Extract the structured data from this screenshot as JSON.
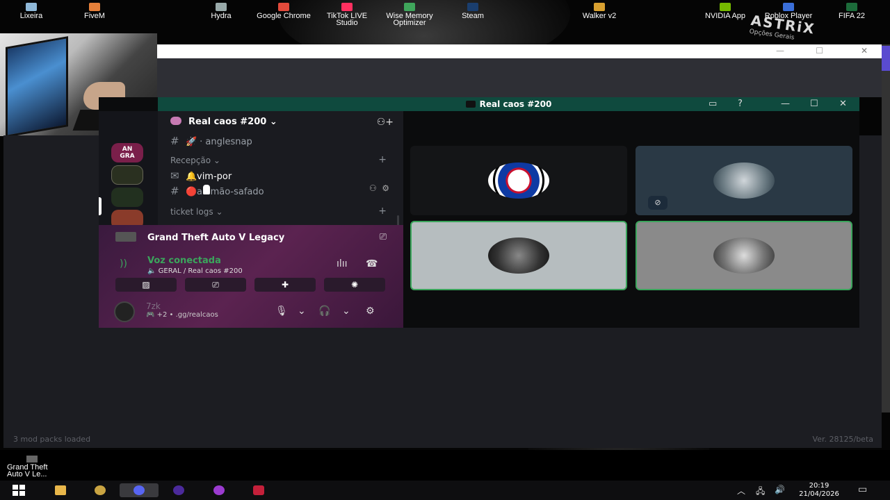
{
  "desktop_icons": [
    {
      "label": "Lixeira",
      "color": "#8fb8d8"
    },
    {
      "label": "FiveM",
      "color": "#e6803a"
    },
    {
      "label": "Hydra",
      "color": "#9aa"
    },
    {
      "label": "Google Chrome",
      "color": "#e24a3b"
    },
    {
      "label": "TikTok LIVE Studio",
      "color": "#ff3060"
    },
    {
      "label": "Wise Memory Optimizer",
      "color": "#3fa65b"
    },
    {
      "label": "Steam",
      "color": "#1a3e6e"
    },
    {
      "label": "Walker v2",
      "color": "#d8a030"
    },
    {
      "label": "NVIDIA App",
      "color": "#76b900"
    },
    {
      "label": "Roblox Player",
      "color": "#3a6ed8"
    },
    {
      "label": "FIFA 22",
      "color": "#1c6b3a"
    }
  ],
  "astrix": {
    "logo": "ASTRiX",
    "sub": "Opções Gerais"
  },
  "launcher": {
    "left_status": "3 mod packs loaded",
    "right_status": "Ver. 28125/beta"
  },
  "whitewin": {
    "min": "—",
    "max": "☐",
    "close": "✕"
  },
  "discord": {
    "window_title": "Real caos #200",
    "titlebar_icons": {
      "inbox": "inbox-icon",
      "help": "help-icon",
      "minimize": "—",
      "maximize": "☐",
      "close": "✕"
    },
    "servers": [
      {
        "label": "AN\nGRA",
        "color": "#7a1f4a"
      },
      {
        "label": "",
        "color": "#2a3020"
      },
      {
        "label": "",
        "color": "#22301f"
      },
      {
        "label": "",
        "color": "#8a3b2a"
      }
    ],
    "server_name": "Real caos #200",
    "channels": [
      {
        "icon": "#",
        "emoji": "🚀",
        "name": "· anglesnap",
        "active": false
      },
      {
        "category": "Recepção",
        "arrow": "⌄",
        "add": "+"
      },
      {
        "icon": "✉",
        "emoji": "🔔",
        "name": "vim-por",
        "active": true
      },
      {
        "icon": "#",
        "emoji": "🔴",
        "name": "alemão-safado",
        "active": false
      },
      {
        "category": "ticket logs",
        "arrow": "⌄",
        "add": "+"
      }
    ],
    "activity": {
      "game": "Grand Theft Auto V Legacy"
    },
    "voice": {
      "title": "Voz conectada",
      "subtitle": "🔈 GERAL / Real caos #200"
    },
    "user": {
      "name": "7zk",
      "status": "🎮 +2 • .gg/realcaos"
    },
    "accent": "#3ba55c"
  },
  "gta_shortcut": {
    "label": "Grand Theft Auto V Le..."
  },
  "taskbar": {
    "time": "20:19",
    "date": "21/04/2026",
    "tray_icons": [
      "chevron-up-icon",
      "network-icon",
      "volume-icon",
      "notification-icon"
    ]
  }
}
